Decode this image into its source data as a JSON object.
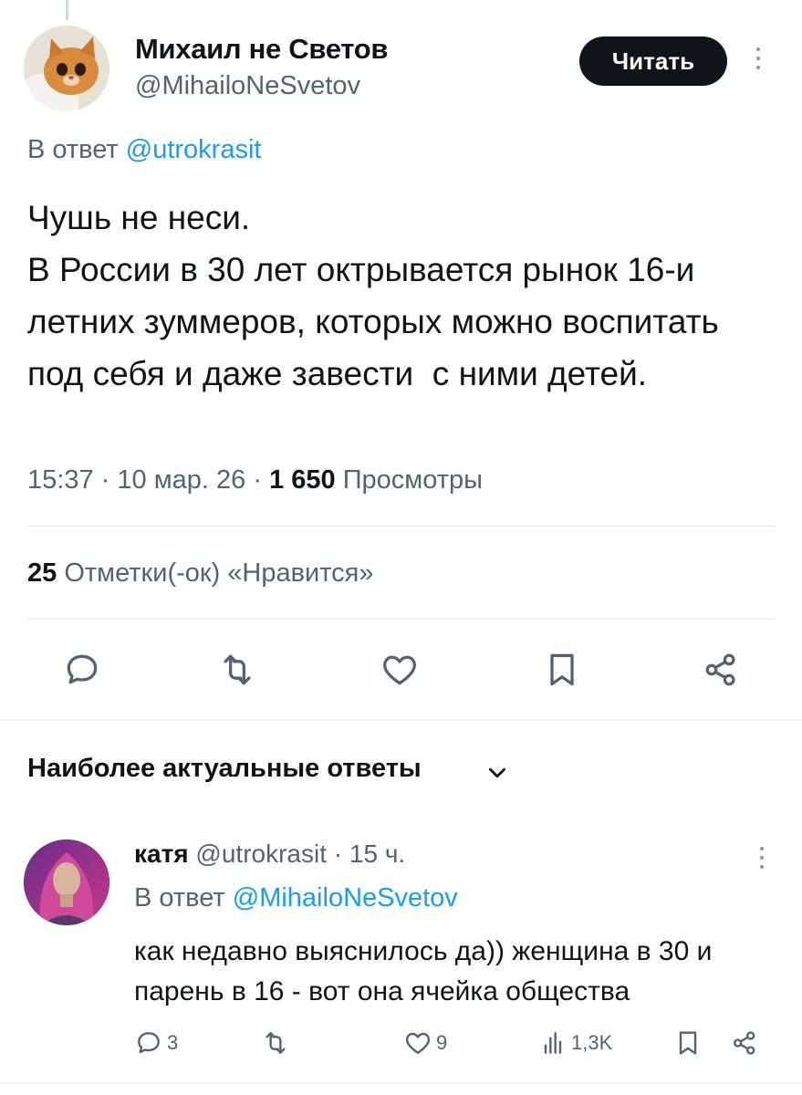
{
  "tweet": {
    "author_name": "Михаил не Светов",
    "author_handle": "@MihailoNeSvetov",
    "follow_label": "Читать",
    "reply_to_prefix": "В ответ ",
    "reply_to_handle": "@utrokrasit",
    "text": "Чушь не неси.\nВ России в 30 лет октрывается рынок 16-и летних зуммеров, которых можно воспитать под себя и даже завести  с ними детей.",
    "time": "15:37",
    "date": "10 мар. 26",
    "views_count": "1 650",
    "views_label": "Просмотры",
    "likes_count": "25",
    "likes_label": "Отметки(-ок) «Нравится»",
    "separator": "·"
  },
  "actions": {
    "reply_icon": "reply-icon",
    "retweet_icon": "retweet-icon",
    "like_icon": "heart-icon",
    "bookmark_icon": "bookmark-icon",
    "share_icon": "share-icon"
  },
  "replies_section": {
    "title": "Наиболее актуальные ответы"
  },
  "reply": {
    "author_name": "катя",
    "author_handle": "@utrokrasit",
    "time_ago": "15 ч.",
    "reply_to_prefix": "В ответ ",
    "reply_to_handle": "@MihailoNeSvetov",
    "text": "как недавно выяснилось да)) женщина в 30 и парень в 16 - вот она ячейка общества",
    "reply_count": "3",
    "like_count": "9",
    "views_count": "1,3K"
  },
  "colors": {
    "text": "#0f1419",
    "secondary": "#536471",
    "link": "#1d9bf0",
    "divider": "#e1e6ea"
  }
}
